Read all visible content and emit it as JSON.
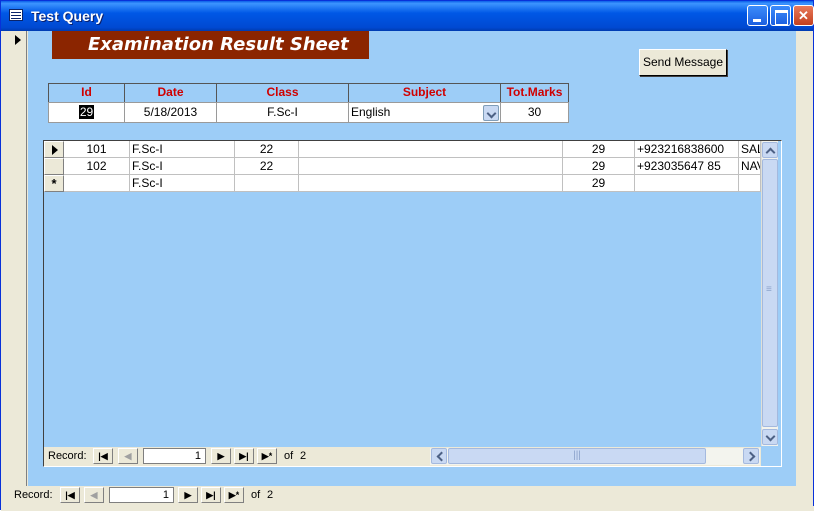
{
  "window": {
    "title": "Test Query"
  },
  "form": {
    "banner": "Examination Result Sheet",
    "send_button": "Send Message",
    "headers": {
      "id": "Id",
      "date": "Date",
      "class": "Class",
      "subject": "Subject",
      "tot_marks": "Tot.Marks"
    },
    "values": {
      "id": "29",
      "date": "5/18/2013",
      "class": "F.Sc-I",
      "subject": "English",
      "tot_marks": "30"
    }
  },
  "subform": {
    "rows": [
      {
        "roll": "101",
        "class": "F.Sc-I",
        "num": "22",
        "blank": "",
        "marks": "29",
        "phone": "+923216838600",
        "name": "SAL"
      },
      {
        "roll": "102",
        "class": "F.Sc-I",
        "num": "22",
        "blank": "",
        "marks": "29",
        "phone": "+923035647 85",
        "name": "NAV"
      },
      {
        "roll": "",
        "class": "F.Sc-I",
        "num": "",
        "blank": "",
        "marks": "29",
        "phone": "",
        "name": ""
      }
    ],
    "nav": {
      "label": "Record:",
      "current": "1",
      "of_label": "of",
      "total": "2"
    }
  },
  "main_nav": {
    "label": "Record:",
    "current": "1",
    "of_label": "of",
    "total": "2"
  },
  "icons": {
    "first": "first-record-icon",
    "prev": "prev-record-icon",
    "next": "next-record-icon",
    "last": "last-record-icon",
    "new": "new-record-icon"
  },
  "colors": {
    "form_bg": "#9DCDF7",
    "banner_bg": "#8B2500",
    "header_text": "#D00000",
    "titlebar": "#0058E6"
  }
}
